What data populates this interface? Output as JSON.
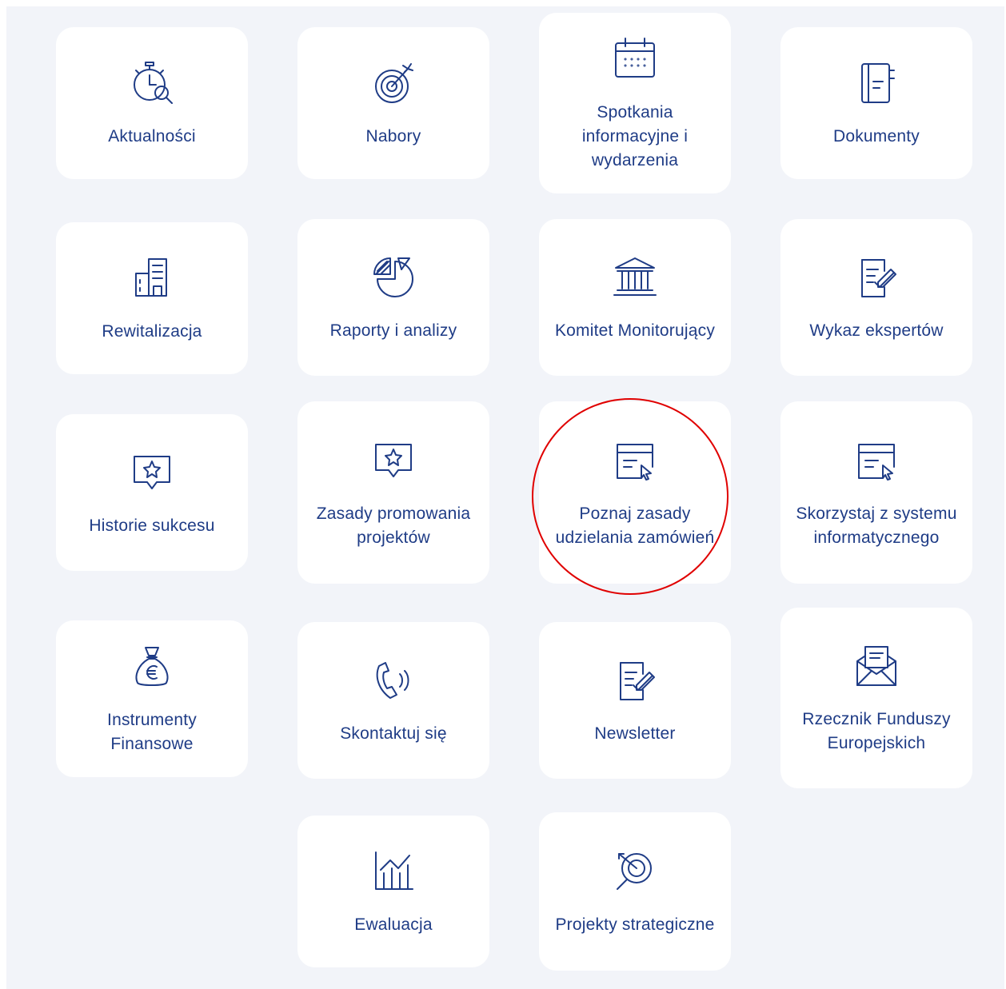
{
  "tiles": [
    {
      "label": "Aktualności",
      "icon": "stopwatch-search-icon"
    },
    {
      "label": "Nabory",
      "icon": "target-icon"
    },
    {
      "label": "Spotkania informacyjne i wydarzenia",
      "icon": "calendar-icon"
    },
    {
      "label": "Dokumenty",
      "icon": "notebook-icon"
    },
    {
      "label": "Rewitalizacja",
      "icon": "buildings-icon"
    },
    {
      "label": "Raporty i analizy",
      "icon": "pie-chart-icon"
    },
    {
      "label": "Komitet Monitorujący",
      "icon": "institution-icon"
    },
    {
      "label": "Wykaz ekspertów",
      "icon": "document-check-icon"
    },
    {
      "label": "Historie sukcesu",
      "icon": "star-bubble-icon"
    },
    {
      "label": "Zasady promowania projektów",
      "icon": "star-bubble-icon"
    },
    {
      "label": "Poznaj zasady udzielania zamówień",
      "icon": "browser-cursor-icon"
    },
    {
      "label": "Skorzystaj z systemu informatycznego",
      "icon": "browser-cursor-icon"
    },
    {
      "label": "Instrumenty Finansowe",
      "icon": "euro-bag-icon"
    },
    {
      "label": "Skontaktuj się",
      "icon": "phone-icon"
    },
    {
      "label": "Newsletter",
      "icon": "document-check-icon"
    },
    {
      "label": "Rzecznik Funduszy Europejskich",
      "icon": "envelope-letter-icon"
    },
    {
      "label": "Ewaluacja",
      "icon": "bar-chart-icon"
    },
    {
      "label": "Projekty strategiczne",
      "icon": "target-magnifier-icon"
    }
  ],
  "colors": {
    "background": "#f2f4f9",
    "tile": "#ffffff",
    "text": "#1f3c86",
    "highlight": "#e00000"
  }
}
